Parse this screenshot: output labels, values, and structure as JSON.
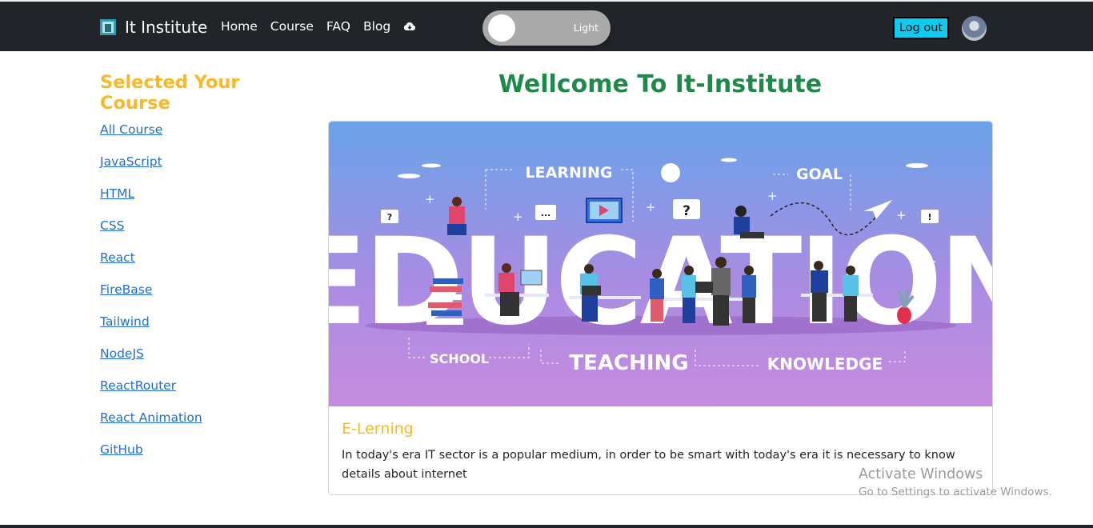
{
  "navbar": {
    "brand_name": "It Institute",
    "links": [
      "Home",
      "Course",
      "FAQ",
      "Blog"
    ],
    "theme_toggle_label": "Light",
    "logout_label": "Log out"
  },
  "sidebar": {
    "title": "Selected Your Course",
    "courses": [
      "All Course",
      "JavaScript",
      "HTML",
      "CSS",
      "React",
      "FireBase",
      "Tailwind",
      "NodeJS",
      "ReactRouter",
      "React Animation",
      "GitHub"
    ]
  },
  "main": {
    "title": "Wellcome To It-Institute",
    "card": {
      "hero_words": {
        "learning": "LEARNING",
        "goal": "GOAL",
        "education": "EDUCATION",
        "school": "SCHOOL",
        "teaching": "TEACHING",
        "knowledge": "KNOWLEDGE"
      },
      "title": "E-Lerning",
      "text": "In today's era IT sector is a popular medium, in order to be smart with today's era it is necessary to know details about internet"
    }
  },
  "os_watermark": {
    "title": "Activate Windows",
    "subtitle": "Go to Settings to activate Windows."
  },
  "colors": {
    "navbar_bg": "#212529",
    "accent_yellow": "#f7b928",
    "title_green": "#1d8a4a",
    "link_blue": "#1f6fd1",
    "logout_cyan": "#0dcaf0"
  },
  "icons": {
    "brand": "brand-logo-icon",
    "cloud": "cloud-download-icon",
    "avatar": "user-avatar"
  }
}
